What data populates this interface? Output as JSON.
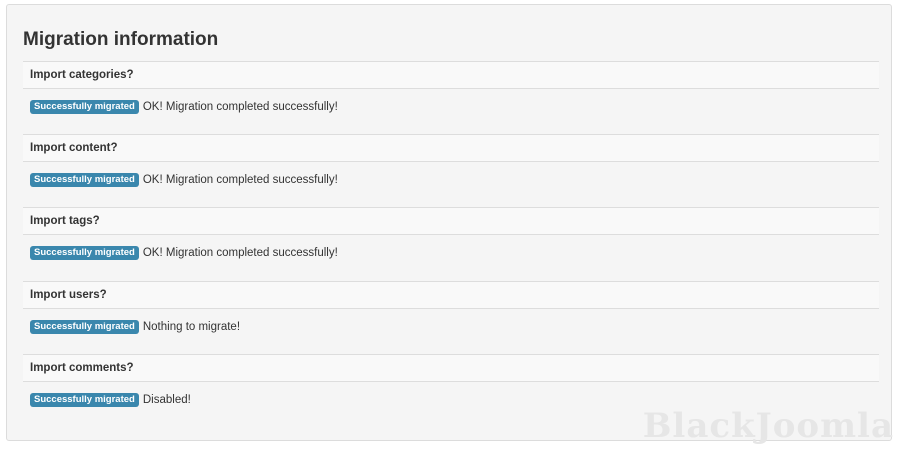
{
  "panel": {
    "title": "Migration information"
  },
  "sections": [
    {
      "label": "Import categories?",
      "badge": "Successfully migrated",
      "message": "OK! Migration completed successfully!"
    },
    {
      "label": "Import content?",
      "badge": "Successfully migrated",
      "message": "OK! Migration completed successfully!"
    },
    {
      "label": "Import tags?",
      "badge": "Successfully migrated",
      "message": "OK! Migration completed successfully!"
    },
    {
      "label": "Import users?",
      "badge": "Successfully migrated",
      "message": "Nothing to migrate!"
    },
    {
      "label": "Import comments?",
      "badge": "Successfully migrated",
      "message": "Disabled!"
    }
  ],
  "watermark": "BlackJoomla",
  "colors": {
    "badge": "#3a87ad",
    "panel_bg": "#f5f5f5",
    "header_bg": "#f9f9f9"
  }
}
